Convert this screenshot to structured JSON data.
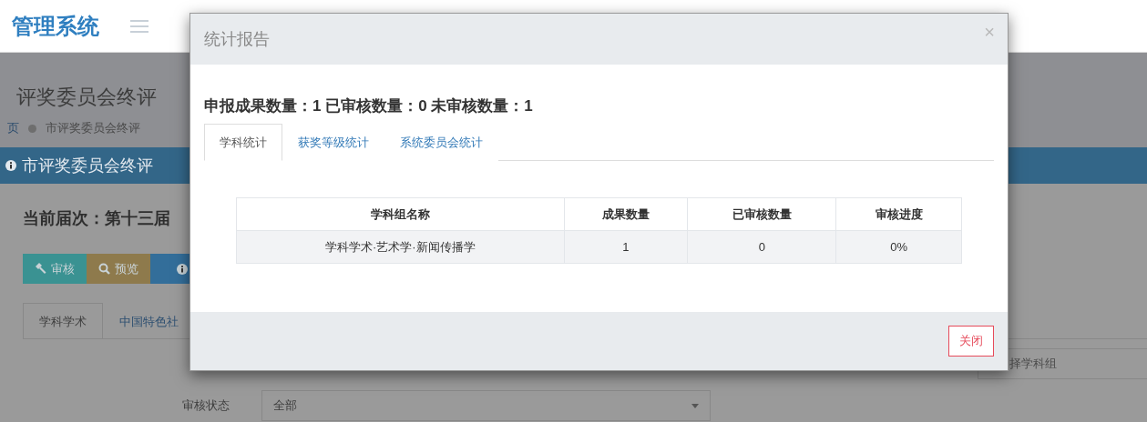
{
  "header": {
    "logo": "管理系统"
  },
  "page": {
    "title": "评奖委员会终评",
    "breadcrumb": [
      {
        "label": "页",
        "kind": "link"
      },
      {
        "label": "市评奖委员会终评",
        "kind": "current"
      }
    ],
    "panel_title": "市评奖委员会终评",
    "session": "当前届次：第十三届",
    "actions": [
      {
        "kind": "audit",
        "label": "审核"
      },
      {
        "kind": "preview",
        "label": "预览"
      },
      {
        "kind": "info"
      }
    ],
    "tabs": [
      {
        "label": "学科学术",
        "selected": true
      },
      {
        "label": "中国特色社",
        "selected": false
      }
    ],
    "group_field": {
      "placeholder": "择学科组"
    },
    "status_filter": {
      "label": "审核状态",
      "value": "全部"
    }
  },
  "dialog": {
    "title": "统计报告",
    "close": "×",
    "summary": "申报成果数量：1 已审核数量：0 未审核数量：1",
    "tabs": [
      {
        "label": "学科统计",
        "selected": true
      },
      {
        "label": "获奖等级统计",
        "selected": false
      },
      {
        "label": "系统委员会统计",
        "selected": false
      }
    ],
    "table": {
      "columns": [
        "学科组名称",
        "成果数量",
        "已审核数量",
        "审核进度"
      ],
      "rows": [
        [
          "学科学术·艺术学·新闻传播学",
          "1",
          "0",
          "0%"
        ]
      ]
    },
    "buttons": [
      "关闭"
    ]
  }
}
